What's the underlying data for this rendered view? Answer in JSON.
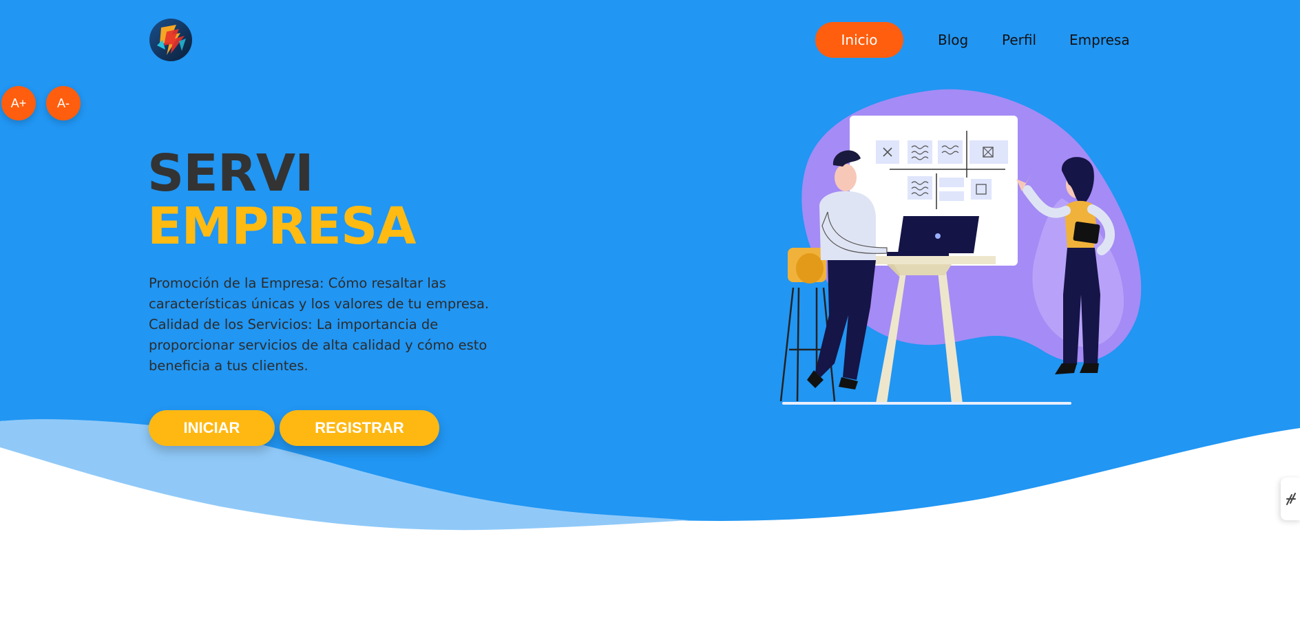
{
  "colors": {
    "hero_background": "#2196f3",
    "wave_light": "#90c9f8",
    "accent_orange": "#ff5e0e",
    "accent_yellow": "#ffbb12",
    "title_dark": "#333333"
  },
  "header": {
    "logo_icon": "brand-logo-icon",
    "nav": [
      {
        "label": "Inicio",
        "active": true
      },
      {
        "label": "Blog",
        "active": false
      },
      {
        "label": "Perfil",
        "active": false
      },
      {
        "label": "Empresa",
        "active": false
      }
    ]
  },
  "font_controls": {
    "increase_label": "A+",
    "decrease_label": "A-"
  },
  "hero": {
    "title_line1": "SERVI",
    "title_line2": "EMPRESA",
    "description": "Promoción de la Empresa: Cómo resaltar las características únicas y los valores de tu empresa. Calidad de los Servicios: La importancia de proporcionar servicios de alta calidad y cómo esto beneficia a tus clientes.",
    "buttons": {
      "primary_label": "INICIAR",
      "secondary_label": "REGISTRAR"
    },
    "illustration_icon": "team-whiteboard-illustration"
  },
  "side_widget": {
    "icon": "accessibility-widget-icon"
  }
}
